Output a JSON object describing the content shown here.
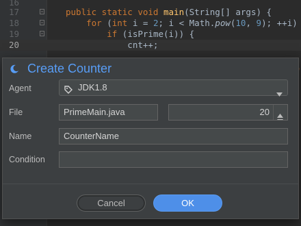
{
  "editor": {
    "lines": [
      {
        "number": "16",
        "code": ""
      },
      {
        "number": "17",
        "code": "public static void main(String[] args) {"
      },
      {
        "number": "18",
        "code": "    for (int i = 2; i < Math.pow(10, 9); ++i) {"
      },
      {
        "number": "19",
        "code": "        if (isPrime(i)) {"
      },
      {
        "number": "20",
        "code": "            cnt++;"
      }
    ]
  },
  "dialog": {
    "title": "Create Counter",
    "title_icon": "moon-icon",
    "agent_label": "Agent",
    "agent_value": "JDK1.8",
    "agent_icon": "tag-icon",
    "file_label": "File",
    "file_value": "PrimeMain.java",
    "line_value": "20",
    "name_label": "Name",
    "name_value": "CounterName",
    "condition_label": "Condition",
    "condition_value": "",
    "cancel_label": "Cancel",
    "ok_label": "OK"
  },
  "colors": {
    "accent": "#589df6",
    "ok_button": "#4e8fe8",
    "dialog_bg": "#3c3f41",
    "editor_bg": "#2b2b2b",
    "keyword": "#cc7832"
  }
}
